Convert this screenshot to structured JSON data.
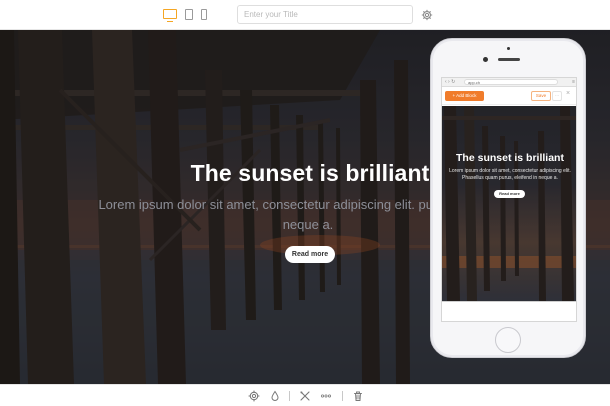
{
  "toolbar": {
    "devices": [
      {
        "icon": "desktop-icon",
        "active": true
      },
      {
        "icon": "tablet-icon",
        "active": false
      },
      {
        "icon": "phone-icon",
        "active": false
      }
    ],
    "title_placeholder": "Enter your Title",
    "settings_icon": "gear-icon",
    "accent_color": "#f5a623"
  },
  "hero": {
    "title": "The sunset is brilliant",
    "text": "Lorem ipsum dolor sit amet, consectetur adipiscing elit. purus, eleifend in neque a.",
    "button": "Read more"
  },
  "preview": {
    "url": "app.ch",
    "add_block": "+ Add Block",
    "save": "Save",
    "more": "···",
    "close": "×",
    "title": "The sunset is brilliant",
    "text": "Lorem ipsum dolor sit amet, consectetur adipiscing elit. Phasellus quam purus, eleifend in neque a.",
    "button": "Read more"
  },
  "bottom_toolbar": {
    "icons": [
      "gear-icon",
      "drop-icon",
      "tools-icon",
      "more-icon",
      "trash-icon"
    ]
  }
}
